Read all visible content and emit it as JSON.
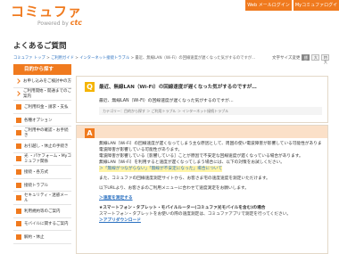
{
  "header": {
    "logo_text": "コミュファ",
    "logo_sub_prefix": "Powered by",
    "logo_sub_brand": "ctc",
    "btn_web_login": "Web メールログイン",
    "btn_my_login": "Myコミュファログイン"
  },
  "page_title": "よくあるご質問",
  "breadcrumb": {
    "items": [
      "コミュファ トップ",
      "ご利用ガイド",
      "インターネット接続トラブル",
      "最近、無線LAN（Wi-Fi）の回線速度が遅くなった気がするのですが..."
    ],
    "separator": " > "
  },
  "font_size": {
    "label": "文字サイズ変更",
    "options": [
      "標準",
      "大",
      "特大"
    ]
  },
  "sidebar": {
    "head": "目的から探す",
    "items": [
      "お申し込みをご検討中の方",
      "ご利用開始・開通までのご案内",
      "ご利用料金・請求・支払",
      "各種オプション",
      "ご利用中の確認・お手続き",
      "お引越し・休止の手続き",
      "光 ・パケフォーム・Myコミュファ関係",
      "接続・各方式",
      "接続トラブル",
      "セキュリティ・迷惑メール",
      "利用規約等のご案内",
      "モバイルに関するご案内",
      "解約・休止"
    ]
  },
  "question": {
    "badge": "Q",
    "title": "最近、無線LAN（Wi-Fi）の回線速度が遅くなった気がするのですが…",
    "text": "最近、無線LAN（Wi-Fi）の回線速度が遅くなった気がするのですが…",
    "category": "カテゴリー：目的から探す ＞ ご利用トラブル ＞ インターネット接続トラブル"
  },
  "answer": {
    "badge": "A",
    "lines": [
      "無線LAN（Wi-Fi）の回線速度が遅くなってしまう主な原因として、周囲の使い電波障害が影響している可能性があります。",
      "電波障害が影響している可能性があります。",
      "電波障害が影響している［影響している］ことが原因で不安定な回線速度が遅くなっている場合があります。",
      "無線LAN（Wi-Fi）を利用すると速度が遅くなってしまう場合には、以下の対策をお試しください。"
    ],
    "highlight": "＞「無線がつながらない」「無線が不安定になった」場合について",
    "lines2": [
      "また、コミュファの回線速度測定サイトから、お客さま宅の速度速度を測定いただけます。",
      "以下URLより、お客さまのご利用メニューに合わせて速度測定をお願いします。"
    ],
    "link_speed": "＞速度を測定する",
    "smartphone_title": "★スマートフォン・タブレット・モバイルルーター(コミュファ光モバイルを含む)の場合",
    "smartphone_text": "スマートフォン・タブレットをお使いの際の速度測定は、コミュファアプリで測定を行ってください。",
    "link_app": "＞アプリダウンロード"
  },
  "colors": {
    "brand": "#f07a1e",
    "q_badge": "#f5b400",
    "link": "#2a70c0"
  }
}
